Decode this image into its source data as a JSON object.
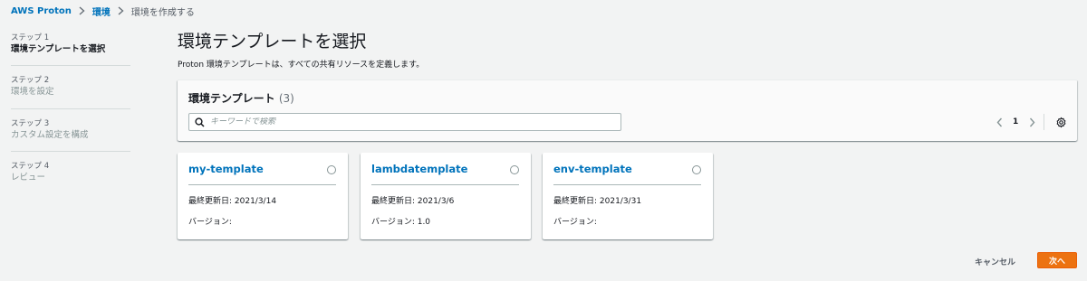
{
  "breadcrumb": {
    "items": [
      "AWS Proton",
      "環境",
      "環境を作成する"
    ]
  },
  "steps": [
    {
      "num": "ステップ 1",
      "title": "環境テンプレートを選択"
    },
    {
      "num": "ステップ 2",
      "title": "環境を設定"
    },
    {
      "num": "ステップ 3",
      "title": "カスタム設定を構成"
    },
    {
      "num": "ステップ 4",
      "title": "レビュー"
    }
  ],
  "header": {
    "title": "環境テンプレートを選択",
    "description": "Proton 環境テンプレートは、すべての共有リソースを定義します。"
  },
  "panel": {
    "title": "環境テンプレート",
    "count": "(3)",
    "search_placeholder": "キーワードで検索",
    "page": "1"
  },
  "cards": [
    {
      "name": "my-template",
      "updated": "最終更新日: 2021/3/14",
      "version": "バージョン:"
    },
    {
      "name": "lambdatemplate",
      "updated": "最終更新日: 2021/3/6",
      "version": "バージョン: 1.0"
    },
    {
      "name": "env-template",
      "updated": "最終更新日: 2021/3/31",
      "version": "バージョン:"
    }
  ],
  "footer": {
    "cancel_label": "キャンセル",
    "next_label": "次へ"
  },
  "colors": {
    "link": "#0073bb",
    "primary_button": "#ec7211",
    "background": "#f2f3f3"
  },
  "icons": [
    "chevron-right-icon",
    "search-icon",
    "chevron-left-icon",
    "gear-icon",
    "radio-icon"
  ]
}
